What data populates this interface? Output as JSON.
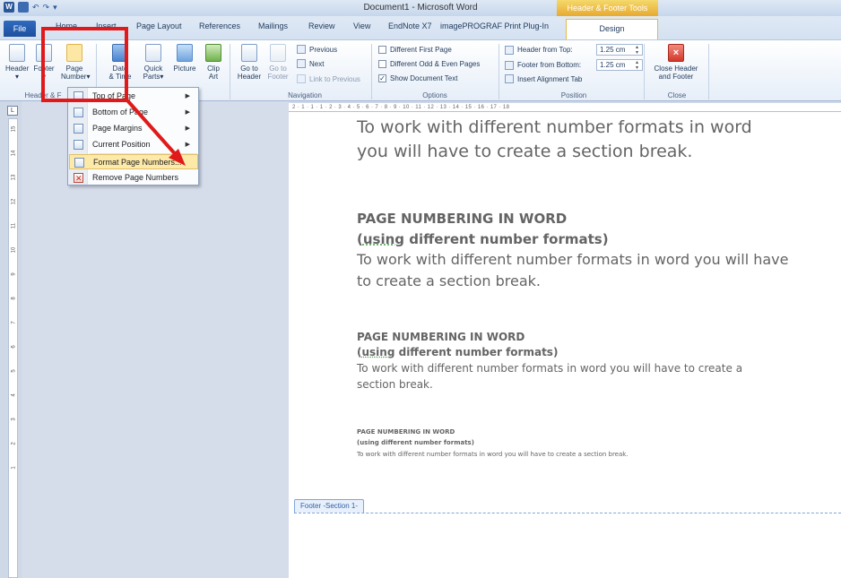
{
  "window": {
    "title": "Document1 - Microsoft Word",
    "context_tab": "Header & Footer Tools"
  },
  "qat": {
    "word_icon": "W",
    "undo_symbol": "↶",
    "redo_symbol": "↷",
    "customize": "▾"
  },
  "tabs": {
    "file": "File",
    "home": "Home",
    "insert": "Insert",
    "page_layout": "Page Layout",
    "references": "References",
    "mailings": "Mailings",
    "review": "Review",
    "view": "View",
    "endnote": "EndNote X7",
    "imageprograf": "imagePROGRAF Print Plug-In",
    "design": "Design"
  },
  "ribbon": {
    "header_label": "Header",
    "footer_label": "Footer",
    "page_label": "Page",
    "number_label": "Number",
    "date_label": "Date",
    "time_label": "& Time",
    "quick_label": "Quick",
    "parts_label": "Parts",
    "picture_label": "Picture",
    "clip_label": "Clip",
    "art_label": "Art",
    "goto_label": "Go to",
    "goto_header": "Header",
    "goto_footer": "Footer",
    "previous": "Previous",
    "next": "Next",
    "link_to_previous": "Link to Previous",
    "diff_first": "Different First Page",
    "diff_odd_even": "Different Odd & Even Pages",
    "show_doc_text": "Show Document Text",
    "header_from_top": "Header from Top:",
    "header_from_top_value": "1.25 cm",
    "footer_from_bottom": "Footer from Bottom:",
    "footer_from_bottom_value": "1.25 cm",
    "insert_alignment_tab": "Insert Alignment Tab",
    "close_line1": "Close Header",
    "close_line2": "and Footer",
    "group_header_footer": "Header & F",
    "group_navigation": "Navigation",
    "group_options": "Options",
    "group_position": "Position",
    "group_close": "Close"
  },
  "menu": {
    "items": [
      {
        "label": "Top of Page",
        "submenu": true
      },
      {
        "label": "Bottom of Page",
        "submenu": true
      },
      {
        "label": "Page Margins",
        "submenu": true
      },
      {
        "label": "Current Position",
        "submenu": true
      },
      {
        "label": "Format Page Numbers...",
        "submenu": false
      },
      {
        "label": "Remove Page Numbers",
        "submenu": false
      }
    ]
  },
  "ruler": {
    "corner": "L",
    "horizontal": "2 · 1 · 1 · 1 · 2 · 3 · 4 · 5 · 6 · 7 · 8 · 9 · 10 · 11 · 12 · 13 · 14 · 15 · 16 · 17 · 18",
    "vertical_ticks": [
      "15",
      "14",
      "13",
      "12",
      "11",
      "10",
      "9",
      "8",
      "7",
      "6",
      "5",
      "4",
      "3",
      "2",
      "1"
    ]
  },
  "document": {
    "block1_line1": "To work with different number formats in word",
    "block1_line2": "you will have to create a section break.",
    "block2_heading": "PAGE NUMBERING IN WORD",
    "block2_sub_open": "(",
    "block2_sub_using": "using",
    "block2_sub_rest": " different number formats)",
    "block2_line1": "To work with different number formats in word you will have",
    "block2_line2": "to create a section break.",
    "block3_heading": "PAGE NUMBERING IN WORD",
    "block3_sub_open": "(",
    "block3_sub_using": "using",
    "block3_sub_rest": " different number formats)",
    "block3_line1": "To work with different number formats in word you will have to create a",
    "block3_line2": "section break.",
    "block4_heading": "PAGE NUMBERING IN WORD",
    "block4_sub": "(using different number formats)",
    "block4_line1": "To work with different number formats in word you will have to create a section break.",
    "footer_tag": "Footer -Section 1-"
  },
  "colors": {
    "highlight_box": "#e01a1a",
    "context_tab": "#e8a930",
    "file_tab": "#2b5ea8"
  }
}
